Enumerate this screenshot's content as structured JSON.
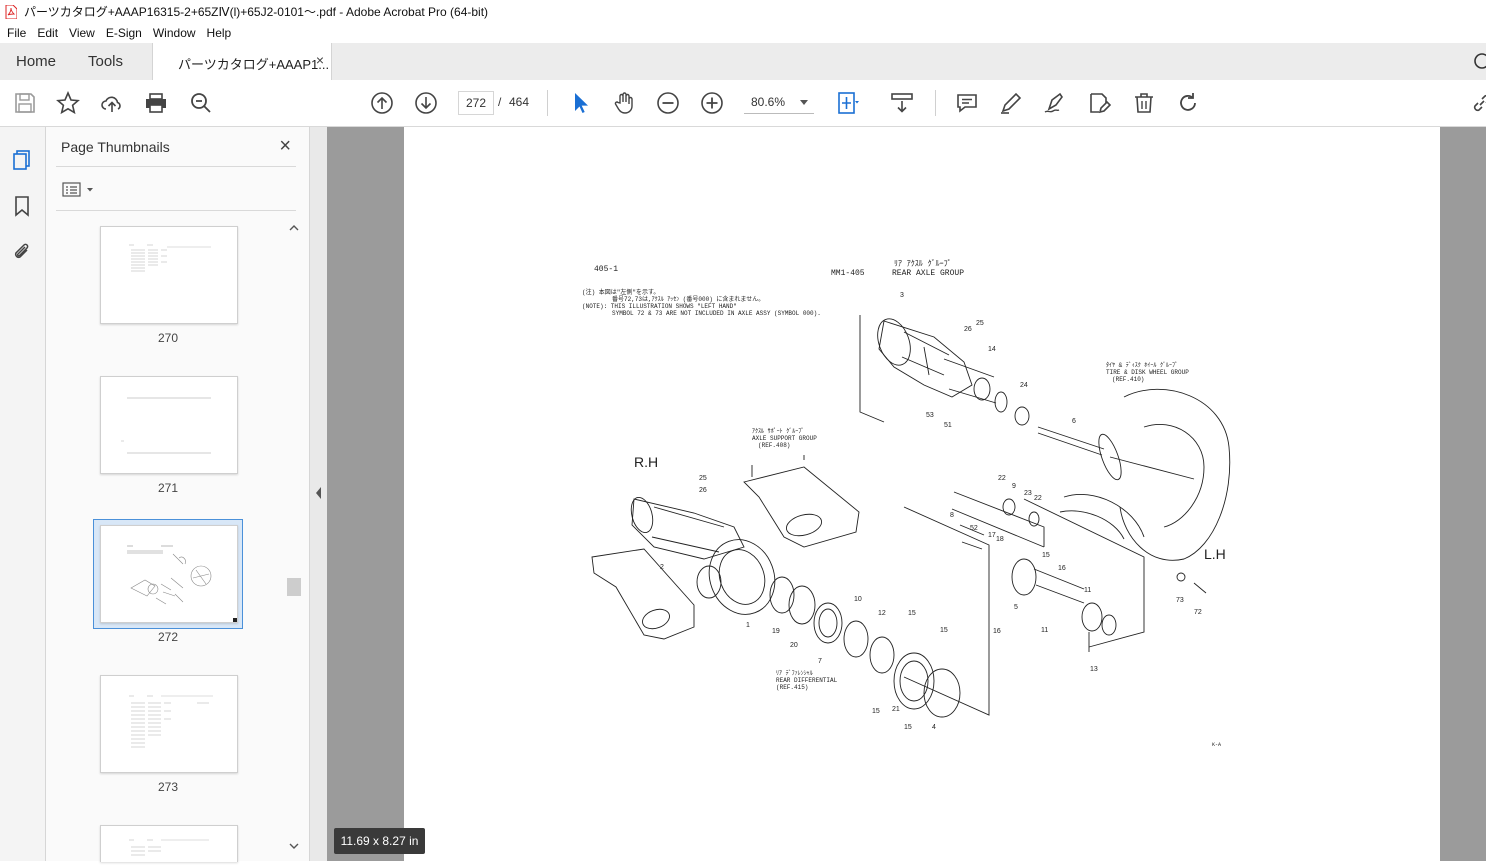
{
  "window": {
    "title": "パーツカタログ+AAAP16315-2+65ZⅣ(l)+65J2-0101～.pdf - Adobe Acrobat Pro (64-bit)"
  },
  "menu": [
    "File",
    "Edit",
    "View",
    "E-Sign",
    "Window",
    "Help"
  ],
  "tabs": {
    "home": "Home",
    "tools": "Tools",
    "document": "パーツカタログ+AAAP1...",
    "close": "×"
  },
  "toolbar": {
    "current_page": "272",
    "separator": "/",
    "total_pages": "464",
    "zoom": "80.6%"
  },
  "panel": {
    "title": "Page Thumbnails",
    "close": "×",
    "thumbnails": [
      {
        "label": "270"
      },
      {
        "label": "271"
      },
      {
        "label": "272",
        "selected": true
      },
      {
        "label": "273"
      }
    ]
  },
  "status": {
    "page_size": "11.69 x 8.27 in"
  },
  "drawing": {
    "page_id": "405-1",
    "group_code": "MM1-405",
    "group_name_jp": "ﾘｱ ｱｸｽﾙ ｸﾞﾙｰﾌﾟ",
    "group_name": "REAR AXLE GROUP",
    "note_jp_1": "(注)   本図は\"左側\"を示す。",
    "note_jp_2": "番号72,73は,ｱｸｽﾙ ｱｯｾﾝ (番号000) に含まれません。",
    "note_1": "(NOTE): THIS ILLUSTRATION SHOWS \"LEFT HAND\"",
    "note_2": "SYMBOL 72 & 73 ARE NOT INCLUDED IN AXLE ASSY (SYMBOL 000).",
    "rh": "R.H",
    "lh": "L.H",
    "axle_support_jp": "ｱｸｽﾙ ｻﾎﾟｰﾄ ｸﾞﾙｰﾌﾟ",
    "axle_support": "AXLE SUPPORT GROUP",
    "axle_support_ref": "(REF.408)",
    "tire_jp": "ﾀｲﾔ & ﾃﾞｨｽｸ ﾎｲｰﾙ ｸﾞﾙｰﾌﾟ",
    "tire": "TIRE & DISK WHEEL GROUP",
    "tire_ref": "(REF.410)",
    "diff_jp": "ﾘｱ ﾃﾞﾌｧﾚﾝｼｬﾙ",
    "diff": "REAR DIFFERENTIAL",
    "diff_ref": "(REF.415)",
    "corner_mark": "K-A",
    "callouts": [
      "3",
      "25",
      "26",
      "14",
      "24",
      "6",
      "53",
      "51",
      "25",
      "26",
      "2",
      "1",
      "19",
      "20",
      "7",
      "10",
      "12",
      "15",
      "15",
      "15",
      "21",
      "15",
      "4",
      "8",
      "52",
      "17",
      "18",
      "22",
      "9",
      "23",
      "22",
      "15",
      "5",
      "16",
      "11",
      "16",
      "11",
      "13",
      "73",
      "72"
    ]
  }
}
